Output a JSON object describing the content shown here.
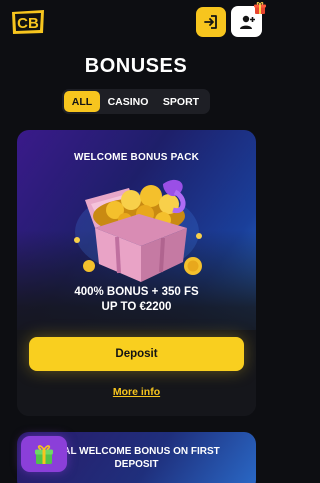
{
  "header": {
    "logo_text": "CB",
    "login_icon": "login-icon",
    "signup_icon": "add-user-icon",
    "signup_badge_icon": "gift-icon"
  },
  "page": {
    "title": "BONUSES"
  },
  "tabs": [
    {
      "label": "ALL",
      "active": true
    },
    {
      "label": "CASINO",
      "active": false
    },
    {
      "label": "SPORT",
      "active": false
    }
  ],
  "bonus_cards": [
    {
      "title": "WELCOME BONUS PACK",
      "image_icon": "treasure-chest-icon",
      "bonus_line1": "400% BONUS + 350 FS",
      "bonus_line2": "UP TO €2200",
      "deposit_label": "Deposit",
      "more_info_label": "More info"
    },
    {
      "title_line1": "CIAL WELCOME BONUS ON FIRST",
      "title_line2": "DEPOSIT"
    }
  ],
  "floating": {
    "gift_icon": "gift-icon"
  },
  "colors": {
    "accent": "#f7c51e",
    "background": "#0d0e12",
    "card": "#15161b",
    "gift_button": "#8b3fd9"
  }
}
